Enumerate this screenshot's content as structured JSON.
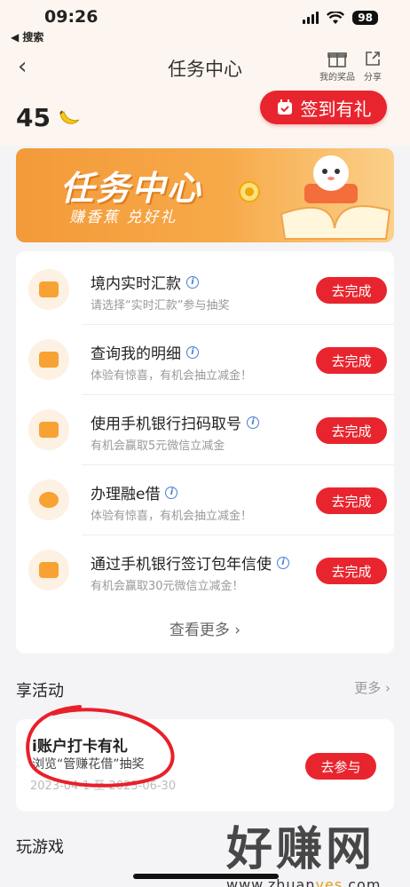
{
  "status": {
    "time": "09:26",
    "back_app": "◀ 搜索",
    "battery": "98"
  },
  "nav": {
    "title": "任务中心",
    "my_prizes": "我的奖品",
    "share": "分享"
  },
  "header": {
    "points": "45",
    "checkin_label": "签到有礼"
  },
  "banner": {
    "title": "任务中心",
    "subtitle": "赚香蕉 兑好礼"
  },
  "tasks": [
    {
      "title": "境内实时汇款",
      "subtitle": "请选择“实时汇款”参与抽奖",
      "button": "去完成",
      "icon": "card-icon"
    },
    {
      "title": "查询我的明细",
      "subtitle": "体验有惊喜，有机会抽立减金！",
      "button": "去完成",
      "icon": "pie-chart-icon"
    },
    {
      "title": "使用手机银行扫码取号",
      "subtitle": "有机会赢取5元微信立减金",
      "button": "去完成",
      "icon": "calendar-icon"
    },
    {
      "title": "办理融e借",
      "subtitle": "体验有惊喜，有机会抽立减金！",
      "button": "去完成",
      "icon": "piggy-bank-icon"
    },
    {
      "title": "通过手机银行签订包年信使",
      "subtitle": "有机会赢取30元微信立减金！",
      "button": "去完成",
      "icon": "calendar-icon"
    }
  ],
  "see_more": "查看更多",
  "activities": {
    "section_title": "享活动",
    "more": "更多",
    "item": {
      "title": "i账户打卡有礼",
      "subtitle": "浏览“管赚花借”抽奖",
      "date": "2023-04-1 至 2023-06-30",
      "button": "去参与"
    }
  },
  "games": {
    "section_title": "玩游戏"
  },
  "watermark": {
    "brand": "好赚网",
    "url_prefix": "www.zhuan",
    "url_highlight": "yes",
    "url_suffix": ".com"
  },
  "colors": {
    "primary_red": "#e8252e",
    "accent_orange": "#f7a233",
    "header_bg": "#fdf6f0"
  }
}
